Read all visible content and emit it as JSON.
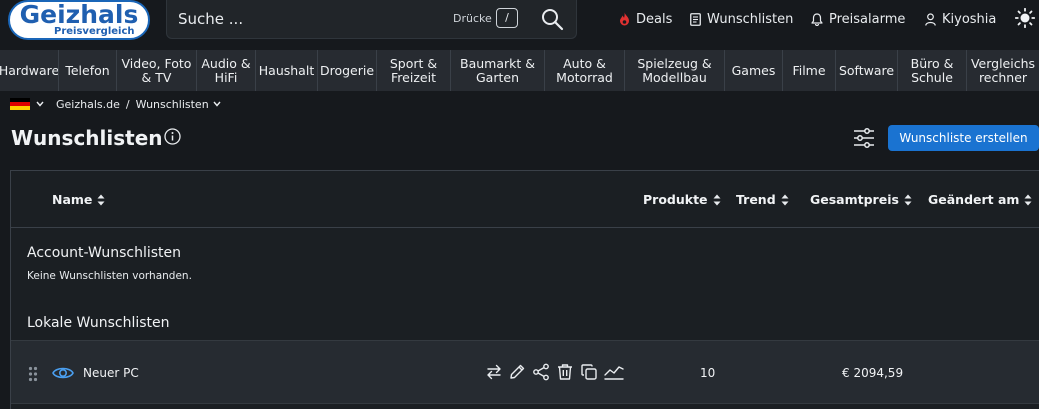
{
  "logo": {
    "name": "Geizhals",
    "sub": "Preisvergleich"
  },
  "search": {
    "placeholder": "Suche ...",
    "hint": "Drücke",
    "shortcut": "/"
  },
  "topnav": {
    "deals": "Deals",
    "wishlists": "Wunschlisten",
    "alarms": "Preisalarme",
    "user": "Kiyoshia"
  },
  "categories": [
    "Hardware",
    "Telefon",
    "Video, Foto\n& TV",
    "Audio &\nHiFi",
    "Haushalt",
    "Drogerie",
    "Sport &\nFreizeit",
    "Baumarkt &\nGarten",
    "Auto &\nMotorrad",
    "Spielzeug &\nModellbau",
    "Games",
    "Filme",
    "Software",
    "Büro &\nSchule",
    "Vergleichs\nrechner"
  ],
  "breadcrumb": {
    "home": "Geizhals.de",
    "separator": "/",
    "current": "Wunschlisten"
  },
  "page": {
    "title": "Wunschlisten",
    "create_button": "Wunschliste erstellen"
  },
  "table": {
    "columns": [
      "Name",
      "Produkte",
      "Trend",
      "Gesamtpreis",
      "Geändert am"
    ],
    "account_section": "Account-Wunschlisten",
    "account_empty": "Keine Wunschlisten vorhanden.",
    "local_section": "Lokale Wunschlisten",
    "rows": [
      {
        "name": "Neuer PC",
        "products": "10",
        "total": "€ 2094,59"
      }
    ]
  },
  "colors": {
    "accent": "#1a73d1",
    "deals": "#e03131",
    "background": "#16191d",
    "category_bar": "#272b31",
    "row": "#262b31"
  }
}
